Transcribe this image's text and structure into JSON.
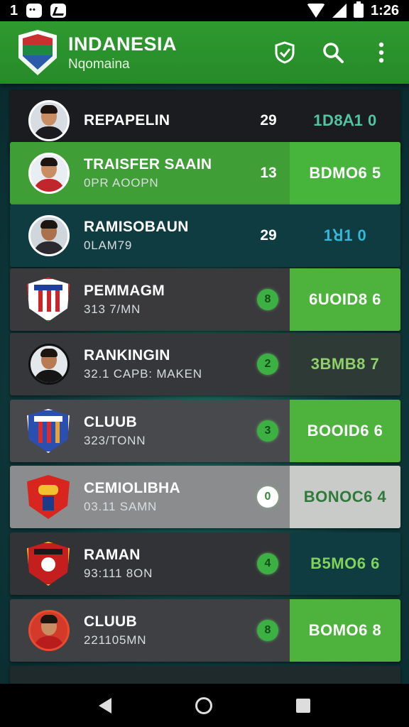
{
  "status_bar": {
    "left_number": "1",
    "time": "1:26"
  },
  "app_bar": {
    "title": "INDANESIA",
    "subtitle": "Nqomaina"
  },
  "rows": [
    {
      "name": "REPAPELIN",
      "sub": "",
      "num": "29",
      "score": "1D8ꓮ1 0",
      "kind": "player",
      "badge": ""
    },
    {
      "name": "TRAISFER SAAIN",
      "sub": "0PR AOOPN",
      "num": "13",
      "score": "BDMO6 5",
      "kind": "player",
      "badge": ""
    },
    {
      "name": "RAMISOBAUN",
      "sub": "0LAM79",
      "num": "29",
      "score": "1ꓤ1 0",
      "kind": "player",
      "badge": ""
    },
    {
      "name": "PEMMAGM",
      "sub": "313 7/MN",
      "num": "",
      "score": "6UOID8 6",
      "kind": "crest",
      "badge": "8"
    },
    {
      "name": "RANKINGIN",
      "sub": "32.1 CAPB: MAKEN",
      "num": "",
      "score": "3BMB8 7",
      "kind": "player",
      "badge": "2"
    },
    {
      "name": "CLUUB",
      "sub": "323/TONN",
      "num": "",
      "score": "BOOID6 6",
      "kind": "crest",
      "badge": "3"
    },
    {
      "name": "CEMIOLIBHA",
      "sub": "03.11 SAMN",
      "num": "",
      "score": "BONOC6 4",
      "kind": "crest",
      "badge": "0"
    },
    {
      "name": "RAMAN",
      "sub": "93:111 8ON",
      "num": "",
      "score": "B5MO6 6",
      "kind": "crest",
      "badge": "4"
    },
    {
      "name": "CLUUB",
      "sub": "221105MN",
      "num": "",
      "score": "BOMO6 8",
      "kind": "player",
      "badge": "8"
    }
  ],
  "colors": {
    "app_bar": "#2f9a30",
    "accent_green": "#4db33d"
  },
  "icons": [
    "shield-check-icon",
    "search-icon",
    "more-vert-icon"
  ]
}
